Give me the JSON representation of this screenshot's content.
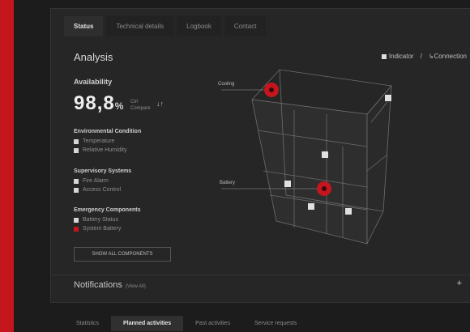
{
  "tabs": [
    "Status",
    "Technical details",
    "Logbook",
    "Contact"
  ],
  "section_title": "Analysis",
  "legend": {
    "item1": "Indicator",
    "item2": "Connection"
  },
  "availability": {
    "label": "Availability",
    "value": "98,8",
    "unit": "%",
    "meta1": "Ctrl",
    "meta2": "Compare",
    "trend": "↓↑"
  },
  "groups": [
    {
      "title": "Environmental Condition",
      "items": [
        "Temperature",
        "Relative Humidity"
      ]
    },
    {
      "title": "Supervisory Systems",
      "items": [
        "Fire Alarm",
        "Access Control"
      ]
    },
    {
      "title": "Emergency Components",
      "items": [
        "Battery Status",
        "System Battery"
      ]
    }
  ],
  "button_all": "SHOW ALL COMPONENTS",
  "callouts": {
    "top": "Cooling",
    "bottom": "Battery"
  },
  "notifications": {
    "label": "Notifications",
    "sub": "(View All)",
    "plus": "+"
  },
  "bottom_tabs": [
    "Statistics",
    "Planned activities",
    "Past activities",
    "Service requests"
  ],
  "colors": {
    "accent": "#c4161c",
    "panel": "#262626",
    "background": "#1c1c1c"
  }
}
